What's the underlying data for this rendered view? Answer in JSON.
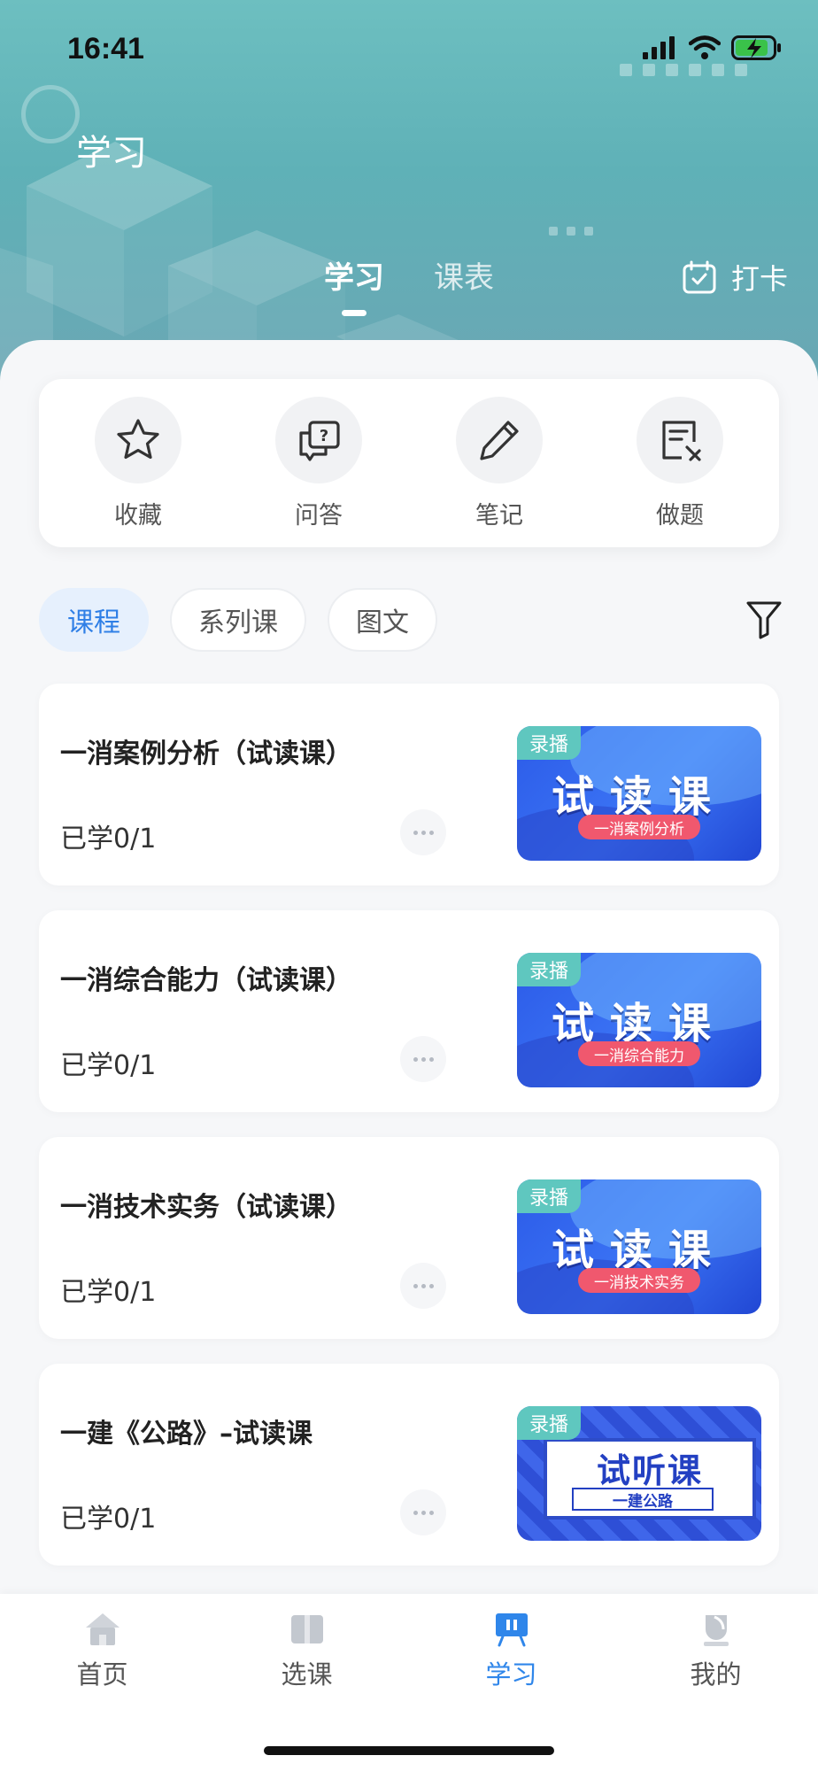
{
  "status_bar": {
    "time": "16:41"
  },
  "header": {
    "title": "学习",
    "tabs": [
      {
        "label": "学习",
        "active": true
      },
      {
        "label": "课表",
        "active": false
      }
    ],
    "checkin_label": "打卡"
  },
  "quick_actions": [
    {
      "label": "收藏",
      "icon": "star-icon"
    },
    {
      "label": "问答",
      "icon": "question-bubble-icon"
    },
    {
      "label": "笔记",
      "icon": "pencil-icon"
    },
    {
      "label": "做题",
      "icon": "exercise-icon"
    }
  ],
  "filters": [
    {
      "label": "课程",
      "active": true
    },
    {
      "label": "系列课",
      "active": false
    },
    {
      "label": "图文",
      "active": false
    }
  ],
  "courses": [
    {
      "title": "一消案例分析（试读课）",
      "progress": "已学0/1",
      "badge": "录播",
      "thumb_main": "试读课",
      "thumb_sub": "一消案例分析"
    },
    {
      "title": "一消综合能力（试读课）",
      "progress": "已学0/1",
      "badge": "录播",
      "thumb_main": "试读课",
      "thumb_sub": "一消综合能力"
    },
    {
      "title": "一消技术实务（试读课）",
      "progress": "已学0/1",
      "badge": "录播",
      "thumb_main": "试读课",
      "thumb_sub": "一消技术实务"
    },
    {
      "title": "一建《公路》–试读课",
      "progress": "已学0/1",
      "badge": "录播",
      "thumb_main": "试听课",
      "thumb_sub": "一建公路"
    }
  ],
  "bottom_nav": [
    {
      "label": "首页",
      "icon": "home-icon",
      "active": false
    },
    {
      "label": "选课",
      "icon": "book-icon",
      "active": false
    },
    {
      "label": "学习",
      "icon": "study-board-icon",
      "active": true
    },
    {
      "label": "我的",
      "icon": "profile-icon",
      "active": false
    }
  ],
  "colors": {
    "accent": "#2f86ea",
    "header_teal": "#5fb1b7",
    "badge_teal": "#5fc7bf",
    "thumb_blue": "#2c5be8",
    "thumb_pink": "#f0586e"
  }
}
